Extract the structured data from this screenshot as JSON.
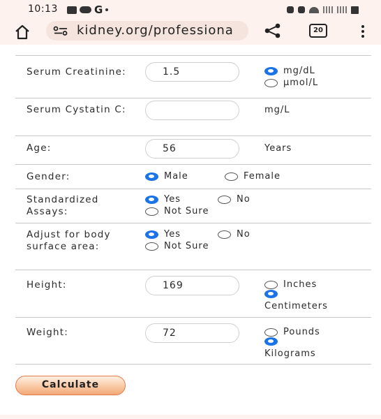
{
  "status_bar": {
    "time": "10:13",
    "left_icons": [
      "photo-icon",
      "cloud-icon",
      "google-icon",
      "dot-icon"
    ],
    "right_icons": [
      "battery-saver-icon",
      "alarm-icon",
      "wifi-icon",
      "signal-icon",
      "signal-icon",
      "battery-icon"
    ]
  },
  "browser": {
    "url": "kidney.org/professiona",
    "tab_count": "20",
    "icons": [
      "home-icon",
      "site-settings-icon",
      "share-icon",
      "tabs-icon",
      "menu-icon"
    ]
  },
  "form": {
    "creatinine": {
      "label": "Serum Creatinine:",
      "value": "1.5",
      "unit_options": [
        {
          "label": "mg/dL",
          "checked": true
        },
        {
          "label": "µmol/L",
          "checked": false
        }
      ]
    },
    "cystatin": {
      "label": "Serum Cystatin C:",
      "value": "",
      "unit": "mg/L"
    },
    "age": {
      "label": "Age:",
      "value": "56",
      "unit": "Years"
    },
    "gender": {
      "label": "Gender:",
      "options": [
        {
          "label": "Male",
          "checked": true
        },
        {
          "label": "Female",
          "checked": false
        }
      ]
    },
    "standardized": {
      "label": "Standardized Assays:",
      "options": [
        {
          "label": "Yes",
          "checked": true
        },
        {
          "label": "No",
          "checked": false
        },
        {
          "label": "Not Sure",
          "checked": false
        }
      ]
    },
    "bsa": {
      "label": "Adjust for body surface area:",
      "options": [
        {
          "label": "Yes",
          "checked": true
        },
        {
          "label": "No",
          "checked": false
        },
        {
          "label": "Not Sure",
          "checked": false
        }
      ]
    },
    "height": {
      "label": "Height:",
      "value": "169",
      "unit_options": [
        {
          "label": "Inches",
          "checked": false
        },
        {
          "label": "Centimeters",
          "checked": true
        }
      ]
    },
    "weight": {
      "label": "Weight:",
      "value": "72",
      "unit_options": [
        {
          "label": "Pounds",
          "checked": false
        },
        {
          "label": "Kilograms",
          "checked": true
        }
      ]
    },
    "calculate_label": "Calculate"
  },
  "colors": {
    "accent": "#1a73e8",
    "chrome_bg": "#fdf2ee",
    "button_border": "#e37a4a"
  }
}
